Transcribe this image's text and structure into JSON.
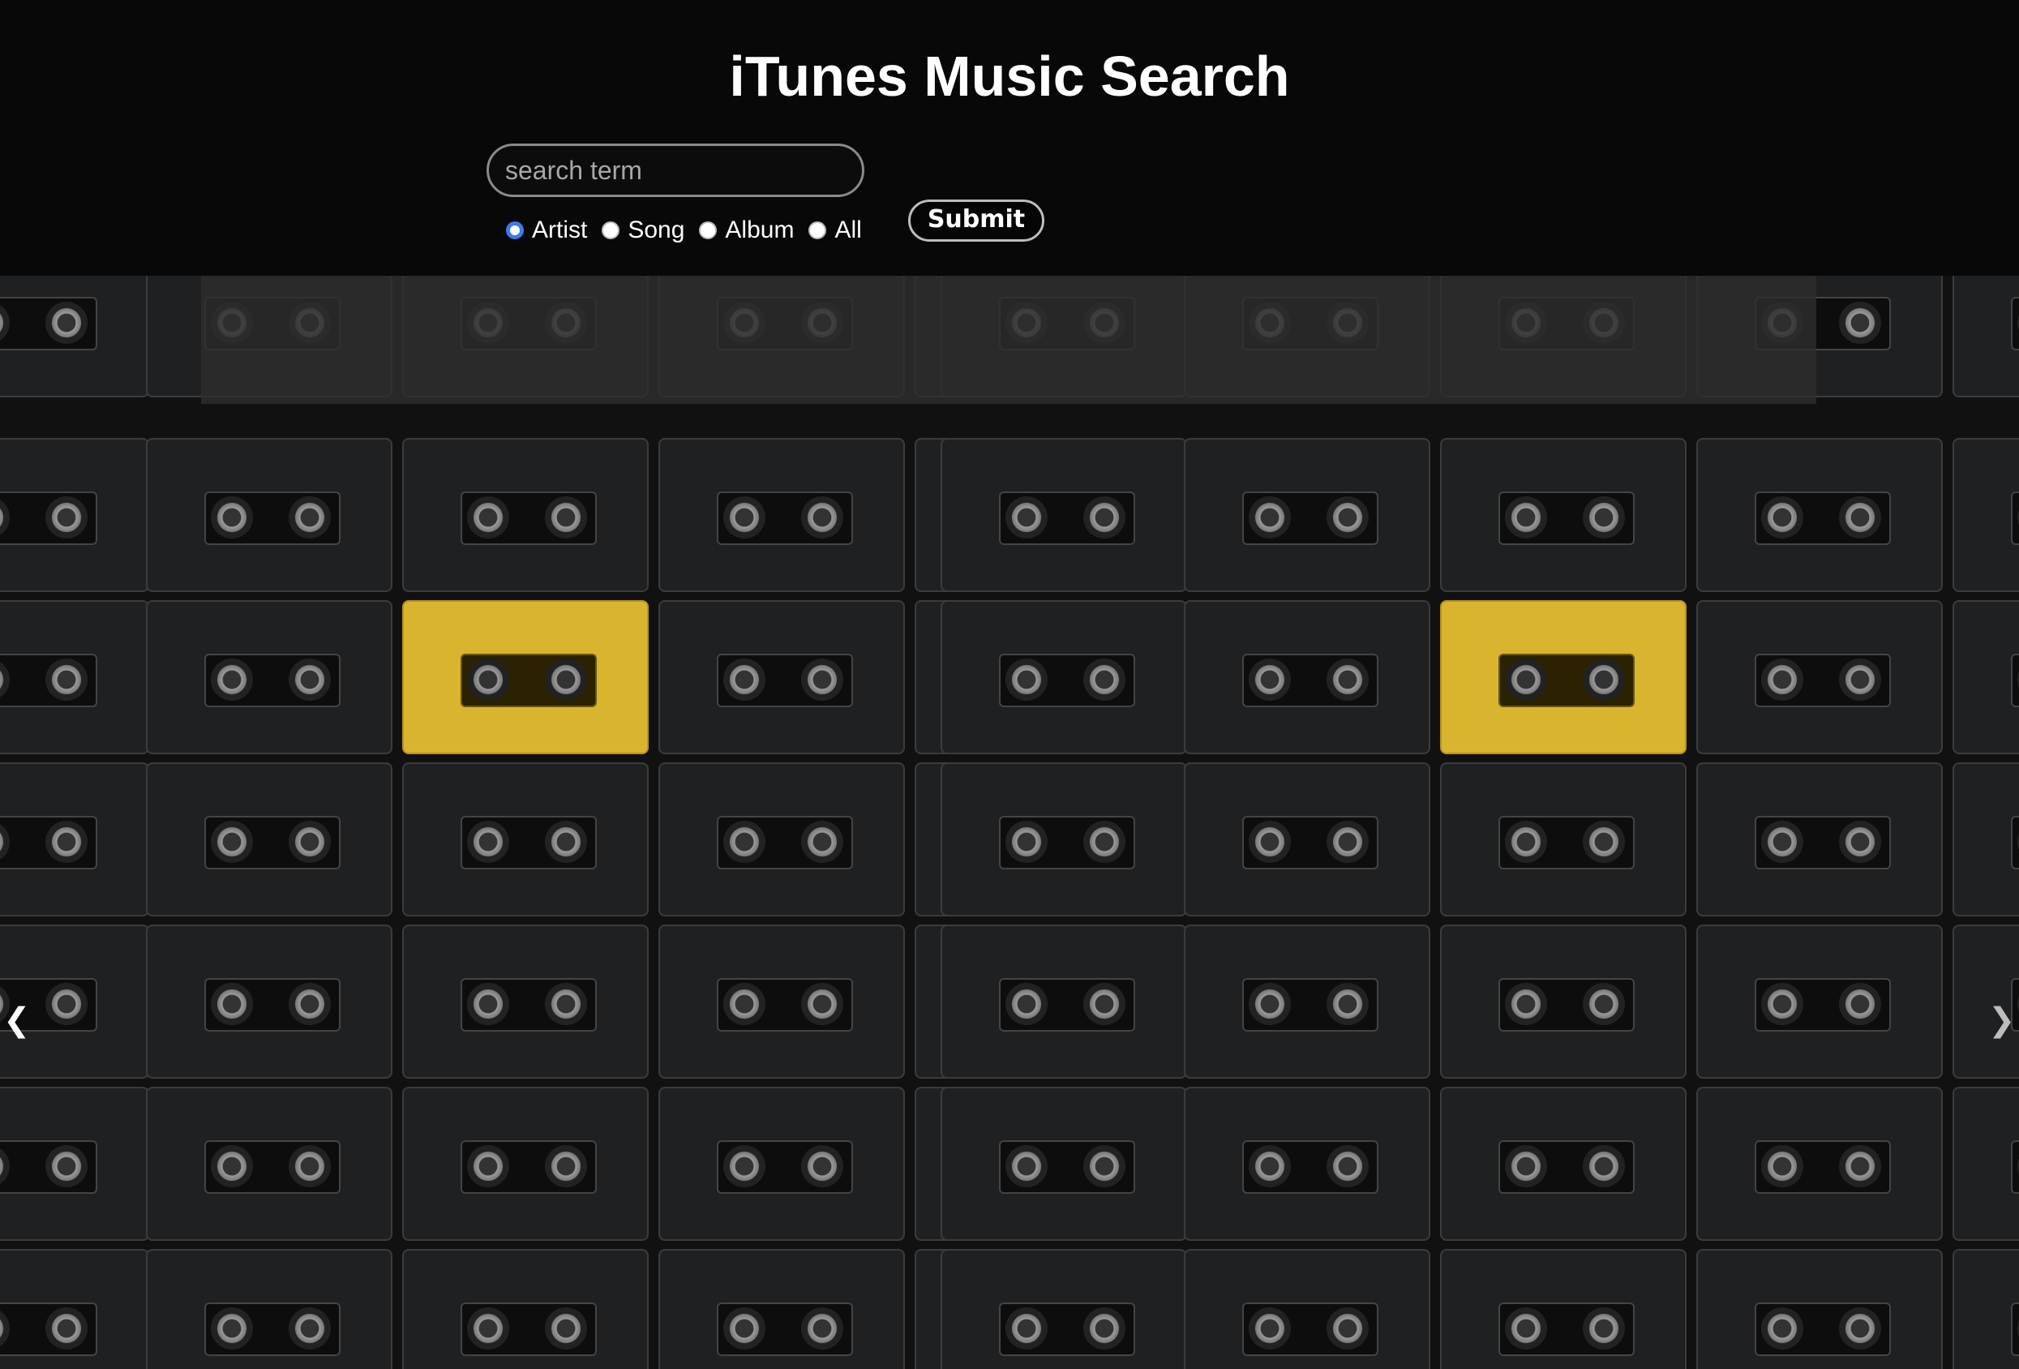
{
  "page": {
    "title": "iTunes Music Search"
  },
  "search": {
    "placeholder": "search term",
    "value": ""
  },
  "filters": {
    "options": [
      {
        "label": "Artist",
        "checked": true
      },
      {
        "label": "Song",
        "checked": false
      },
      {
        "label": "Album",
        "checked": false
      },
      {
        "label": "All",
        "checked": false
      }
    ]
  },
  "actions": {
    "submit_label": "Submit"
  },
  "carousel": {
    "prev_icon": "chevron-left-icon",
    "next_icon": "chevron-right-icon"
  },
  "colors": {
    "background": "#0a0a0a",
    "accent_radio": "#3a7cf0",
    "results_overlay": "#2d2d2d",
    "cassette_highlight": "#d9b42e"
  }
}
